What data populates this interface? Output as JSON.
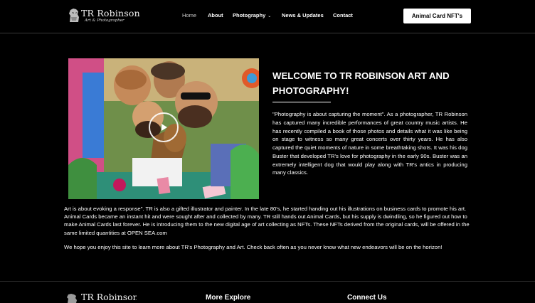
{
  "header": {
    "logo_title": "TR Robinson",
    "logo_subtitle": "Art & Photographer",
    "nav": {
      "home": "Home",
      "about": "About",
      "photography": "Photography",
      "news": "News & Updates",
      "contact": "Contact"
    },
    "cta_label": "Animal Card NFT's"
  },
  "main": {
    "welcome_title": "WELCOME TO TR ROBINSON ART AND PHOTOGRAPHY!",
    "intro_paragraph": "\"Photography is about capturing the moment\". As a photographer, TR Robinson has captured many incredible performances of great country music artists. He has recently compiled a book of those photos and details what it was like being on stage to witness so many great concerts over thirty years. He has also captured the quiet moments of nature in some breathtaking shots. It was his dog Buster that developed TR's love for photography in the early 90s. Buster was an extremely intelligent dog that would play along with TR's antics in producing many classics.",
    "art_paragraph": "Art is about evoking a response\". TR is also a gifted illustrator and painter. In the late 80's, he started handing out his illustrations on business cards to promote his art. Animal Cards became an instant hit and were sought after and collected by many. TR still hands out Animal Cards, but his supply is dwindling, so he figured out how to make Animal Cards last forever. He is introducing them to the new digital age of art collecting as NFTs. These NFTs derived from the original cards, will be offered in the same limited quantities at OPEN SEA.com",
    "closing_paragraph": "We hope you enjoy this site to learn more about TR's Photography and Art. Check back often as you never know what new endeavors will be on the horizon!"
  },
  "footer": {
    "logo_title": "TR Robinson",
    "more_explore": "More Explore",
    "connect_us": "Connect Us"
  },
  "icons": {
    "logo": "dog-logo-icon",
    "play": "play-icon",
    "dropdown": "chevron-down-icon"
  }
}
